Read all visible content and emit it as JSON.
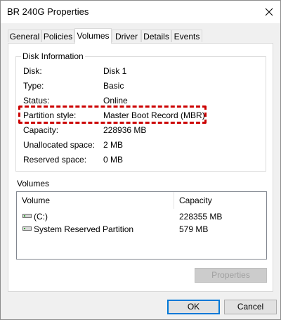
{
  "window": {
    "title": "BR 240G Properties"
  },
  "tabs": [
    {
      "label": "General"
    },
    {
      "label": "Policies"
    },
    {
      "label": "Volumes"
    },
    {
      "label": "Driver"
    },
    {
      "label": "Details"
    },
    {
      "label": "Events"
    }
  ],
  "active_tab": "Volumes",
  "disk_info": {
    "legend": "Disk Information",
    "rows": [
      {
        "label": "Disk:",
        "value": "Disk 1"
      },
      {
        "label": "Type:",
        "value": "Basic"
      },
      {
        "label": "Status:",
        "value": "Online"
      },
      {
        "label": "Partition style:",
        "value": "Master Boot Record (MBR)"
      },
      {
        "label": "Capacity:",
        "value": "228936 MB"
      },
      {
        "label": "Unallocated space:",
        "value": "2 MB"
      },
      {
        "label": "Reserved space:",
        "value": "0 MB"
      }
    ],
    "highlight_color": "#cc0000"
  },
  "volumes": {
    "label": "Volumes",
    "columns": [
      "Volume",
      "Capacity"
    ],
    "rows": [
      {
        "volume": "(C:)",
        "capacity": "228355 MB",
        "icon": "drive-icon"
      },
      {
        "volume": "System Reserved Partition",
        "capacity": "579 MB",
        "icon": "drive-icon"
      }
    ],
    "properties_button": "Properties"
  },
  "buttons": {
    "ok": "OK",
    "cancel": "Cancel"
  },
  "colors": {
    "accent": "#0078d7",
    "dialog_bg": "#f0f0f0"
  }
}
